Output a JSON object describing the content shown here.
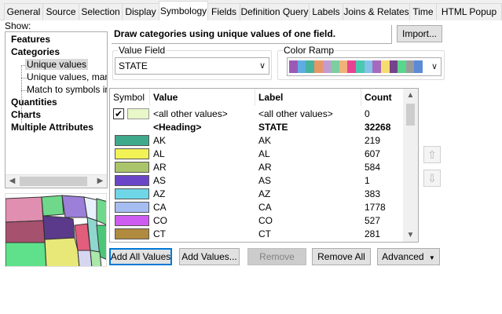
{
  "tabs": [
    "General",
    "Source",
    "Selection",
    "Display",
    "Symbology",
    "Fields",
    "Definition Query",
    "Labels",
    "Joins & Relates",
    "Time",
    "HTML Popup"
  ],
  "active_tab": "Symbology",
  "show_label": "Show:",
  "tree": {
    "features": "Features",
    "categories": "Categories",
    "unique_values": "Unique values",
    "unique_values_many": "Unique values, many",
    "match_to_symbols": "Match to symbols in a",
    "quantities": "Quantities",
    "charts": "Charts",
    "multiple_attributes": "Multiple Attributes"
  },
  "description": "Draw categories using unique values of one field.",
  "import_button": "Import...",
  "value_field": {
    "label": "Value Field",
    "value": "STATE"
  },
  "color_ramp": {
    "label": "Color Ramp",
    "colors": [
      "#9b59b6",
      "#5dade2",
      "#45b39d",
      "#e59866",
      "#c39bd3",
      "#7dcea0",
      "#f0b27a",
      "#e84393",
      "#48c9b0",
      "#85c1e9",
      "#a569bd",
      "#f7dc6f",
      "#76448a",
      "#58d68d",
      "#9b9b9b",
      "#5b8ad6"
    ]
  },
  "table": {
    "headers": {
      "symbol": "Symbol",
      "value": "Value",
      "label": "Label",
      "count": "Count"
    },
    "rows": [
      {
        "value": "<all other values>",
        "label": "<all other values>",
        "count": "0",
        "checked": true,
        "color": "#e8f8c8",
        "bold": false
      },
      {
        "value": "<Heading>",
        "label": "STATE",
        "count": "32268",
        "color": "",
        "bold": true
      },
      {
        "value": "AK",
        "label": "AK",
        "count": "219",
        "color": "#3fa98c",
        "bold": false
      },
      {
        "value": "AL",
        "label": "AL",
        "count": "607",
        "color": "#f2f256",
        "bold": false
      },
      {
        "value": "AR",
        "label": "AR",
        "count": "584",
        "color": "#a9c46a",
        "bold": false
      },
      {
        "value": "AS",
        "label": "AS",
        "count": "1",
        "color": "#6a45c8",
        "bold": false
      },
      {
        "value": "AZ",
        "label": "AZ",
        "count": "383",
        "color": "#6fd6e8",
        "bold": false
      },
      {
        "value": "CA",
        "label": "CA",
        "count": "1778",
        "color": "#a6bdf2",
        "bold": false
      },
      {
        "value": "CO",
        "label": "CO",
        "count": "527",
        "color": "#cf5cf0",
        "bold": false
      },
      {
        "value": "CT",
        "label": "CT",
        "count": "281",
        "color": "#b08a3e",
        "bold": false
      }
    ]
  },
  "buttons": {
    "add_all_values": "Add All Values",
    "add_values": "Add Values...",
    "remove": "Remove",
    "remove_all": "Remove All",
    "advanced": "Advanced"
  }
}
